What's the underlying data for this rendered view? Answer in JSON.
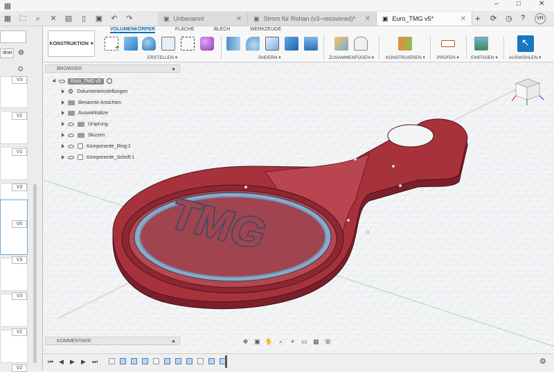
{
  "tabs": {
    "tab1": "Unbenannt",
    "tab2": "Strom für Rohan (v3~recovered)*",
    "tab3": "Euro_TMG v5*"
  },
  "user": {
    "initials": "VR"
  },
  "leftpanel": {
    "button_fragment": "dner",
    "versions": [
      "V3",
      "V2",
      "V1",
      "V3",
      "V5",
      "V3",
      "V3",
      "V2",
      "V2"
    ]
  },
  "ribbon": {
    "workspace": "KONSTRUKTION",
    "tabs": [
      "VOLUMENKÖRPER",
      "FLÄCHE",
      "BLECH",
      "WERKZEUGE"
    ],
    "groups": [
      "ERSTELLEN",
      "ÄNDERN",
      "ZUSAMMENFÜGEN",
      "KONSTRUIEREN",
      "PRÜFEN",
      "EINFÜGEN",
      "AUSWÄHLEN"
    ]
  },
  "browser": {
    "title": "BROWSER",
    "root": "Euro_TMG v5",
    "items": [
      "Dokumenteinstellungen",
      "Benannte Ansichten",
      "Auswahlsätze",
      "Ursprung",
      "Skizzen",
      "Komponente_Ring:1",
      "Komponente_Schrift:1"
    ]
  },
  "model": {
    "emboss_text": "TMG"
  },
  "comments": {
    "label": "KOMMENTARE"
  },
  "colors": {
    "body": "#a8323c",
    "emboss": "#8fa9c4",
    "accent": "#0a6fb8"
  }
}
